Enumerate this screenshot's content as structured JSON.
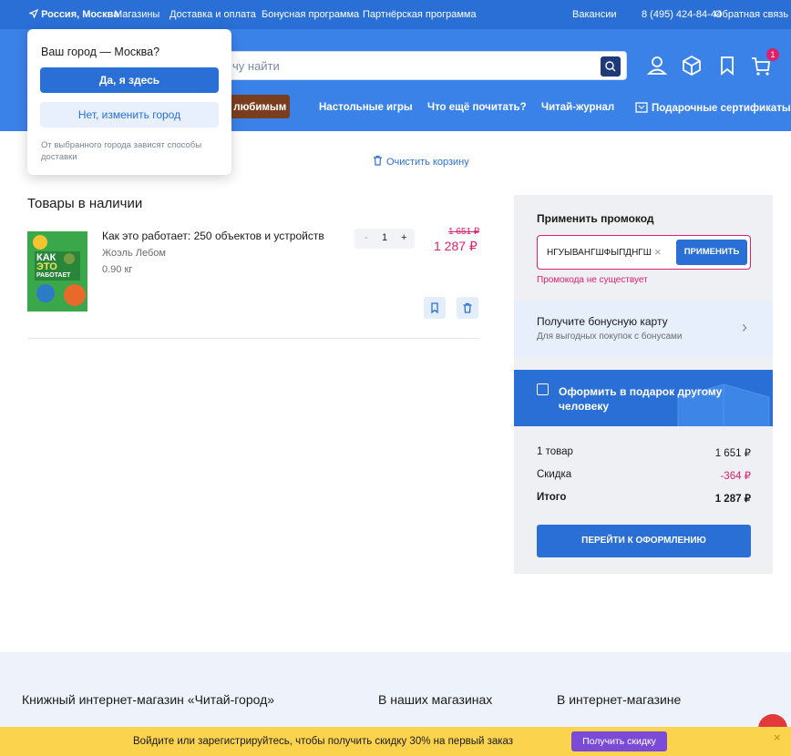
{
  "topbar": {
    "city": "Россия, Москва",
    "links": [
      "Магазины",
      "Доставка и оплата",
      "Бонусная программа",
      "Партнёрская программа"
    ],
    "vacancies": "Вакансии",
    "phone": "8 (495) 424-84-44",
    "feedback": "Обратная связь"
  },
  "header": {
    "search_placeholder": "чу найти",
    "cart_badge": "1",
    "icons": [
      "search-icon",
      "profile-icon",
      "box-icon",
      "bookmark-icon",
      "cart-icon"
    ]
  },
  "nav": {
    "items": [
      "и любимым",
      "Настольные игры",
      "Что ещё почитать?",
      "Читай-журнал",
      "Подарочные сертификаты"
    ]
  },
  "city_popup": {
    "title": "Ваш город — Москва?",
    "confirm": "Да, я здесь",
    "change": "Нет, изменить город",
    "note": "От выбранного города зависят способы доставки"
  },
  "cart": {
    "clear": "Очистить корзину",
    "section_title": "Товары в наличии",
    "items": [
      {
        "title": "Как это работает: 250 объектов и устройств",
        "author": "Жоэль Лебом",
        "weight": "0.90 кг",
        "qty": "1",
        "minus": "-",
        "plus": "+",
        "old_price": "1 651 ₽",
        "price": "1 287 ₽",
        "cover_text": [
          "КАК",
          "ЭТО",
          "РАБОТАЕТ"
        ]
      }
    ]
  },
  "promo": {
    "label": "Применить промокод",
    "value": "НГУЫВАНГШФЫПДНГШ",
    "clear": "×",
    "apply": "ПРИМЕНИТЬ",
    "error": "Промокода не существует"
  },
  "bonus": {
    "title": "Получите бонусную карту",
    "subtitle": "Для выгодных покупок с бонусами"
  },
  "gift": {
    "label": "Оформить в подарок другому человеку"
  },
  "summary": {
    "items_label": "1 товар",
    "items_value": "1 651 ₽",
    "discount_label": "Скидка",
    "discount_value": "-364 ₽",
    "total_label": "Итого",
    "total_value": "1 287 ₽",
    "checkout": "ПЕРЕЙТИ К ОФОРМЛЕНИЮ"
  },
  "footer": {
    "col1": "Книжный интернет-магазин «Читай-город»",
    "col2": "В наших магазинах",
    "col3": "В интернет-магазине"
  },
  "promo_bar": {
    "text": "Войдите или зарегистрируйтесь, чтобы получить скидку 30% на первый заказ",
    "button": "Получить скидку",
    "close": "×"
  },
  "colors": {
    "brand_blue": "#2a6fd6",
    "accent_pink": "#e0206b",
    "promo_yellow": "#fcd34d",
    "promo_purple": "#7b4bd8"
  }
}
